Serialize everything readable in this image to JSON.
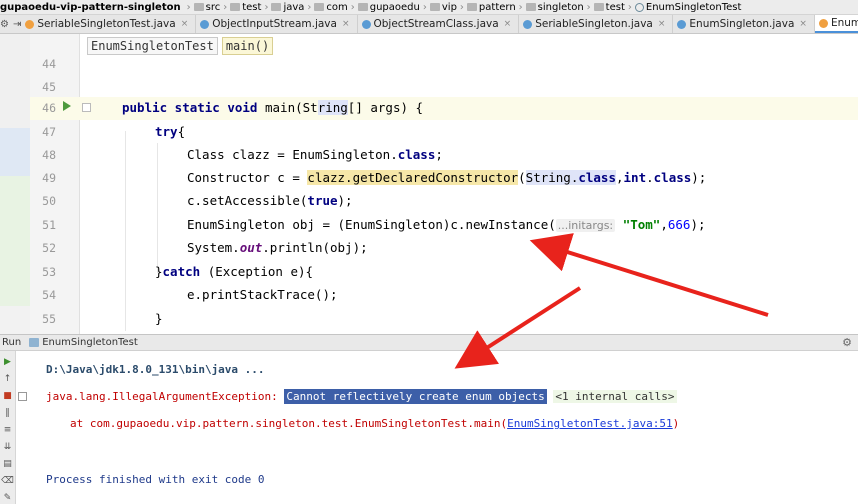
{
  "breadcrumbs": [
    {
      "label": "gupaoedu-vip-pattern-singleton",
      "icon": "project-icon"
    },
    {
      "label": "src",
      "icon": "folder-icon"
    },
    {
      "label": "test",
      "icon": "folder-icon"
    },
    {
      "label": "java",
      "icon": "folder-icon"
    },
    {
      "label": "com",
      "icon": "folder-icon"
    },
    {
      "label": "gupaoedu",
      "icon": "folder-icon"
    },
    {
      "label": "vip",
      "icon": "folder-icon"
    },
    {
      "label": "pattern",
      "icon": "folder-icon"
    },
    {
      "label": "singleton",
      "icon": "folder-icon"
    },
    {
      "label": "test",
      "icon": "folder-icon"
    },
    {
      "label": "EnumSingletonTest",
      "icon": "class-icon"
    }
  ],
  "tabs": [
    {
      "label": "SeriableSingletonTest.java",
      "color": "#f0a040",
      "active": false
    },
    {
      "label": "ObjectInputStream.java",
      "color": "#5a9bd4",
      "active": false
    },
    {
      "label": "ObjectStreamClass.java",
      "color": "#5a9bd4",
      "active": false
    },
    {
      "label": "SeriableSingleton.java",
      "color": "#5a9bd4",
      "active": false
    },
    {
      "label": "EnumSingleton.java",
      "color": "#5a9bd4",
      "active": false
    },
    {
      "label": "EnumSingletonTest.java",
      "color": "#f0a040",
      "active": true
    }
  ],
  "method_breadcrumb": {
    "class_name": "EnumSingletonTest",
    "method_name": "main()"
  },
  "code_lines": [
    {
      "num": "44"
    },
    {
      "num": "45"
    },
    {
      "num": "46"
    },
    {
      "num": "47"
    },
    {
      "num": "48"
    },
    {
      "num": "49"
    },
    {
      "num": "50"
    },
    {
      "num": "51"
    },
    {
      "num": "52"
    },
    {
      "num": "53"
    },
    {
      "num": "54"
    },
    {
      "num": "55"
    }
  ],
  "code": {
    "l46_kw": "public static void",
    "l46_rest_a": " main(St",
    "l46_hl": "ring",
    "l46_rest_b": "[] args) {",
    "l47_kw": "try",
    "l47_rest": "{",
    "l48_a": "Class clazz = EnumSingleton.",
    "l48_kw": "class",
    "l48_b": ";",
    "l49_a": "Constructor c = ",
    "l49_hl": "clazz.getDeclaredConstructor",
    "l49_b": "(",
    "l49_arg": "String.",
    "l49_kw1": "class",
    "l49_c": ",",
    "l49_kw2": "int",
    "l49_d": ".",
    "l49_kw3": "class",
    "l49_e": ");",
    "l50_a": "c.setAccessible(",
    "l50_kw": "true",
    "l50_b": ");",
    "l51_a": "EnumSingleton obj = (EnumSingleton)c.newInstance(",
    "l51_hint": "...initargs:",
    "l51_str": "\"Tom\"",
    "l51_c": ",",
    "l51_num": "666",
    "l51_d": ");",
    "l52_a": "System.",
    "l52_it": "out",
    "l52_b": ".println(obj);",
    "l53_a": "}",
    "l53_kw": "catch",
    "l53_b": " (Exception e){",
    "l54_a": "e.printStackTrace();",
    "l55_a": "}"
  },
  "run_panel": {
    "label": "Run",
    "config_name": "EnumSingletonTest"
  },
  "console": {
    "command": "D:\\Java\\jdk1.8.0_131\\bin\\java ...",
    "exception_prefix": "java.lang.IllegalArgumentException: ",
    "exception_message": "Cannot reflectively create enum objects",
    "internal_calls": "<1 internal calls>",
    "stack_prefix": "at com.gupaoedu.vip.pattern.singleton.test.EnumSingletonTest.main(",
    "stack_link": "EnumSingletonTest.java:51",
    "stack_suffix": ")",
    "finished": "Process finished with exit code 0"
  },
  "colors": {
    "arrow": "#e8231c",
    "selection": "#3d5fa8",
    "error_text": "#c00000"
  }
}
